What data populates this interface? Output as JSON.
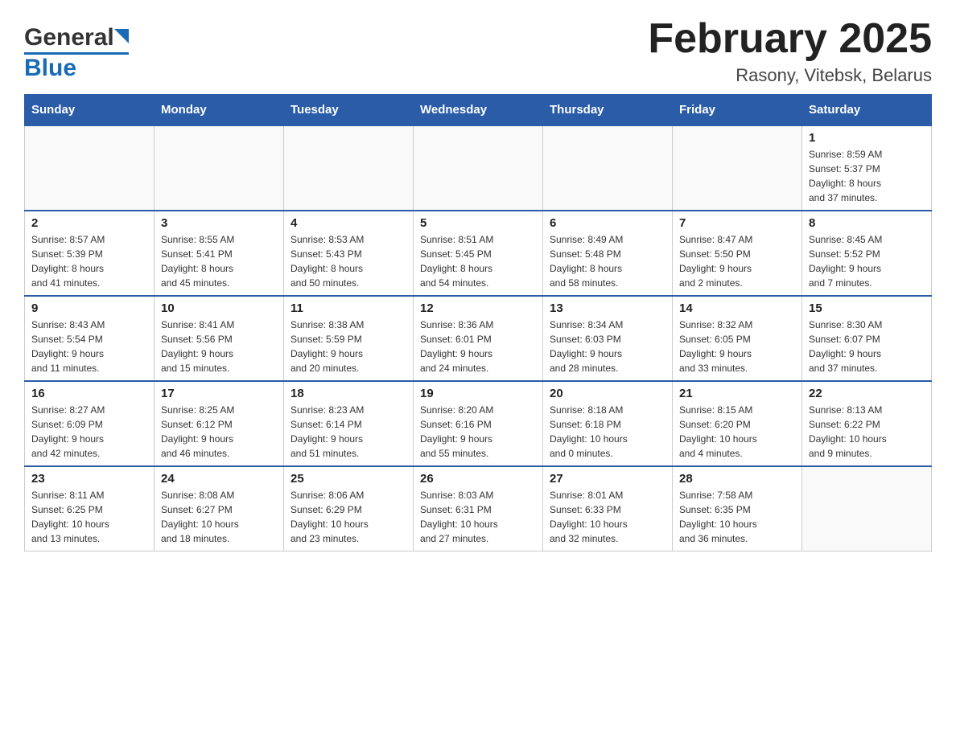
{
  "header": {
    "logo_general": "General",
    "logo_blue": "Blue",
    "month_title": "February 2025",
    "location": "Rasony, Vitebsk, Belarus"
  },
  "weekdays": [
    "Sunday",
    "Monday",
    "Tuesday",
    "Wednesday",
    "Thursday",
    "Friday",
    "Saturday"
  ],
  "weeks": [
    [
      {
        "day": "",
        "info": ""
      },
      {
        "day": "",
        "info": ""
      },
      {
        "day": "",
        "info": ""
      },
      {
        "day": "",
        "info": ""
      },
      {
        "day": "",
        "info": ""
      },
      {
        "day": "",
        "info": ""
      },
      {
        "day": "1",
        "info": "Sunrise: 8:59 AM\nSunset: 5:37 PM\nDaylight: 8 hours\nand 37 minutes."
      }
    ],
    [
      {
        "day": "2",
        "info": "Sunrise: 8:57 AM\nSunset: 5:39 PM\nDaylight: 8 hours\nand 41 minutes."
      },
      {
        "day": "3",
        "info": "Sunrise: 8:55 AM\nSunset: 5:41 PM\nDaylight: 8 hours\nand 45 minutes."
      },
      {
        "day": "4",
        "info": "Sunrise: 8:53 AM\nSunset: 5:43 PM\nDaylight: 8 hours\nand 50 minutes."
      },
      {
        "day": "5",
        "info": "Sunrise: 8:51 AM\nSunset: 5:45 PM\nDaylight: 8 hours\nand 54 minutes."
      },
      {
        "day": "6",
        "info": "Sunrise: 8:49 AM\nSunset: 5:48 PM\nDaylight: 8 hours\nand 58 minutes."
      },
      {
        "day": "7",
        "info": "Sunrise: 8:47 AM\nSunset: 5:50 PM\nDaylight: 9 hours\nand 2 minutes."
      },
      {
        "day": "8",
        "info": "Sunrise: 8:45 AM\nSunset: 5:52 PM\nDaylight: 9 hours\nand 7 minutes."
      }
    ],
    [
      {
        "day": "9",
        "info": "Sunrise: 8:43 AM\nSunset: 5:54 PM\nDaylight: 9 hours\nand 11 minutes."
      },
      {
        "day": "10",
        "info": "Sunrise: 8:41 AM\nSunset: 5:56 PM\nDaylight: 9 hours\nand 15 minutes."
      },
      {
        "day": "11",
        "info": "Sunrise: 8:38 AM\nSunset: 5:59 PM\nDaylight: 9 hours\nand 20 minutes."
      },
      {
        "day": "12",
        "info": "Sunrise: 8:36 AM\nSunset: 6:01 PM\nDaylight: 9 hours\nand 24 minutes."
      },
      {
        "day": "13",
        "info": "Sunrise: 8:34 AM\nSunset: 6:03 PM\nDaylight: 9 hours\nand 28 minutes."
      },
      {
        "day": "14",
        "info": "Sunrise: 8:32 AM\nSunset: 6:05 PM\nDaylight: 9 hours\nand 33 minutes."
      },
      {
        "day": "15",
        "info": "Sunrise: 8:30 AM\nSunset: 6:07 PM\nDaylight: 9 hours\nand 37 minutes."
      }
    ],
    [
      {
        "day": "16",
        "info": "Sunrise: 8:27 AM\nSunset: 6:09 PM\nDaylight: 9 hours\nand 42 minutes."
      },
      {
        "day": "17",
        "info": "Sunrise: 8:25 AM\nSunset: 6:12 PM\nDaylight: 9 hours\nand 46 minutes."
      },
      {
        "day": "18",
        "info": "Sunrise: 8:23 AM\nSunset: 6:14 PM\nDaylight: 9 hours\nand 51 minutes."
      },
      {
        "day": "19",
        "info": "Sunrise: 8:20 AM\nSunset: 6:16 PM\nDaylight: 9 hours\nand 55 minutes."
      },
      {
        "day": "20",
        "info": "Sunrise: 8:18 AM\nSunset: 6:18 PM\nDaylight: 10 hours\nand 0 minutes."
      },
      {
        "day": "21",
        "info": "Sunrise: 8:15 AM\nSunset: 6:20 PM\nDaylight: 10 hours\nand 4 minutes."
      },
      {
        "day": "22",
        "info": "Sunrise: 8:13 AM\nSunset: 6:22 PM\nDaylight: 10 hours\nand 9 minutes."
      }
    ],
    [
      {
        "day": "23",
        "info": "Sunrise: 8:11 AM\nSunset: 6:25 PM\nDaylight: 10 hours\nand 13 minutes."
      },
      {
        "day": "24",
        "info": "Sunrise: 8:08 AM\nSunset: 6:27 PM\nDaylight: 10 hours\nand 18 minutes."
      },
      {
        "day": "25",
        "info": "Sunrise: 8:06 AM\nSunset: 6:29 PM\nDaylight: 10 hours\nand 23 minutes."
      },
      {
        "day": "26",
        "info": "Sunrise: 8:03 AM\nSunset: 6:31 PM\nDaylight: 10 hours\nand 27 minutes."
      },
      {
        "day": "27",
        "info": "Sunrise: 8:01 AM\nSunset: 6:33 PM\nDaylight: 10 hours\nand 32 minutes."
      },
      {
        "day": "28",
        "info": "Sunrise: 7:58 AM\nSunset: 6:35 PM\nDaylight: 10 hours\nand 36 minutes."
      },
      {
        "day": "",
        "info": ""
      }
    ]
  ]
}
